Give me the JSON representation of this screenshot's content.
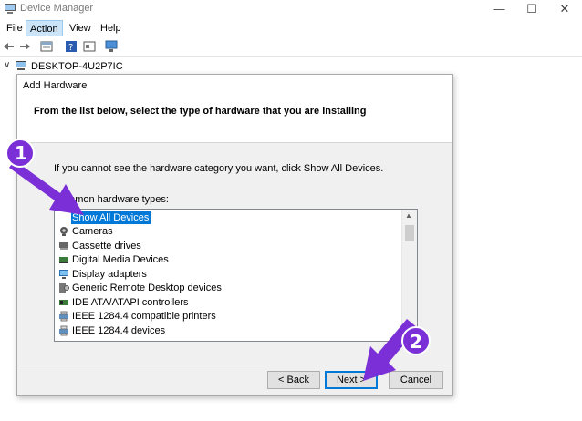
{
  "window": {
    "title": "Device Manager",
    "minimize": "—",
    "maximize": "☐",
    "close": "✕"
  },
  "menu": {
    "items": [
      "File",
      "Action",
      "View",
      "Help"
    ]
  },
  "tree": {
    "root_label": "DESKTOP-4U2P7IC"
  },
  "dialog": {
    "title": "Add Hardware",
    "header": "From the list below, select the type of hardware that you are installing",
    "hint": "If you cannot see the hardware category you want, click Show All Devices.",
    "list_title": "Common hardware types:",
    "items": [
      "Show All Devices",
      "Cameras",
      "Cassette drives",
      "Digital Media Devices",
      "Display adapters",
      "Generic Remote Desktop devices",
      "IDE ATA/ATAPI controllers",
      "IEEE 1284.4 compatible printers",
      "IEEE 1284.4 devices"
    ],
    "selected_index": 0,
    "buttons": {
      "back": "< Back",
      "next": "Next >",
      "cancel": "Cancel"
    }
  },
  "annotations": {
    "step1": "1",
    "step2": "2",
    "color": "#7b2fd6"
  }
}
